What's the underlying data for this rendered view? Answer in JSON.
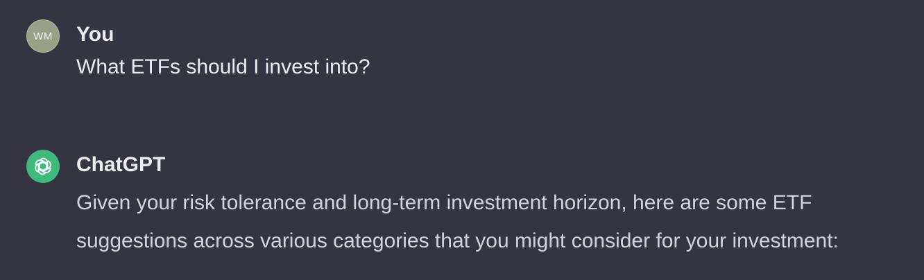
{
  "conversation": {
    "user": {
      "avatar_initials": "WM",
      "author": "You",
      "message": "What ETFs should I invest into?"
    },
    "assistant": {
      "avatar_icon": "openai-logo-icon",
      "author": "ChatGPT",
      "line1": "Given your risk tolerance and long-term investment horizon, here are some ETF",
      "line2": "suggestions across various categories that you might consider for your investment:"
    }
  },
  "colors": {
    "background": "#343541",
    "user_avatar": "#9aa087",
    "assistant_avatar": "#3fb97c"
  }
}
